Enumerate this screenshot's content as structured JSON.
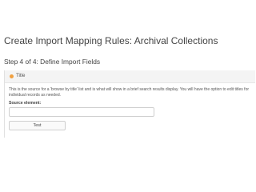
{
  "page": {
    "title": "Create Import Mapping Rules: Archival Collections",
    "step": "Step 4 of 4: Define Import Fields"
  },
  "panel": {
    "title": "Title",
    "description": "This is the source for a 'browse by title' list and is what will show in a brief search results display. You will have the option to edit titles for individual records as needed.",
    "source_label": "Source element:",
    "source_value": "",
    "test_label": "Test"
  },
  "colors": {
    "accent_dot": "#f0a040",
    "panel_header_bg": "#f4f4f4"
  }
}
